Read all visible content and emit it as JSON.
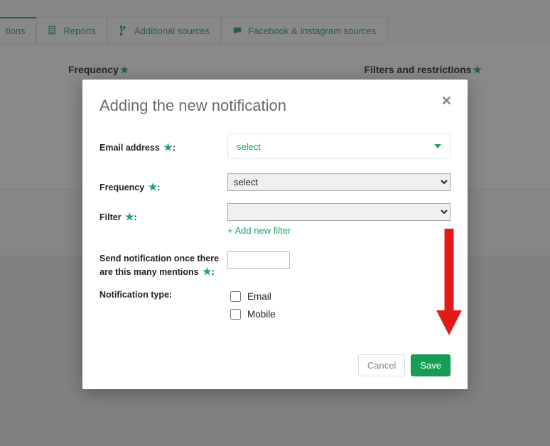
{
  "tabs": {
    "tions_suffix": "tions",
    "reports": "Reports",
    "additional_sources": "Additional sources",
    "fb_ig_sources": "Facebook & Instagram sources"
  },
  "background": {
    "frequency_label": "Frequency",
    "filters_label": "Filters and restrictions"
  },
  "modal": {
    "title": "Adding the new notification",
    "close_symbol": "✕",
    "labels": {
      "email": "Email address",
      "frequency": "Frequency",
      "filter": "Filter",
      "threshold": "Send notification once there are this many mentions",
      "notif_type": "Notification type:"
    },
    "colon": ":",
    "email_select_placeholder": "select",
    "frequency_select_value": "select",
    "filter_select_value": "",
    "add_filter_link": "+ Add new filter",
    "threshold_value": "",
    "checkbox_email": "Email",
    "checkbox_mobile": "Mobile"
  },
  "buttons": {
    "cancel": "Cancel",
    "save": "Save"
  }
}
